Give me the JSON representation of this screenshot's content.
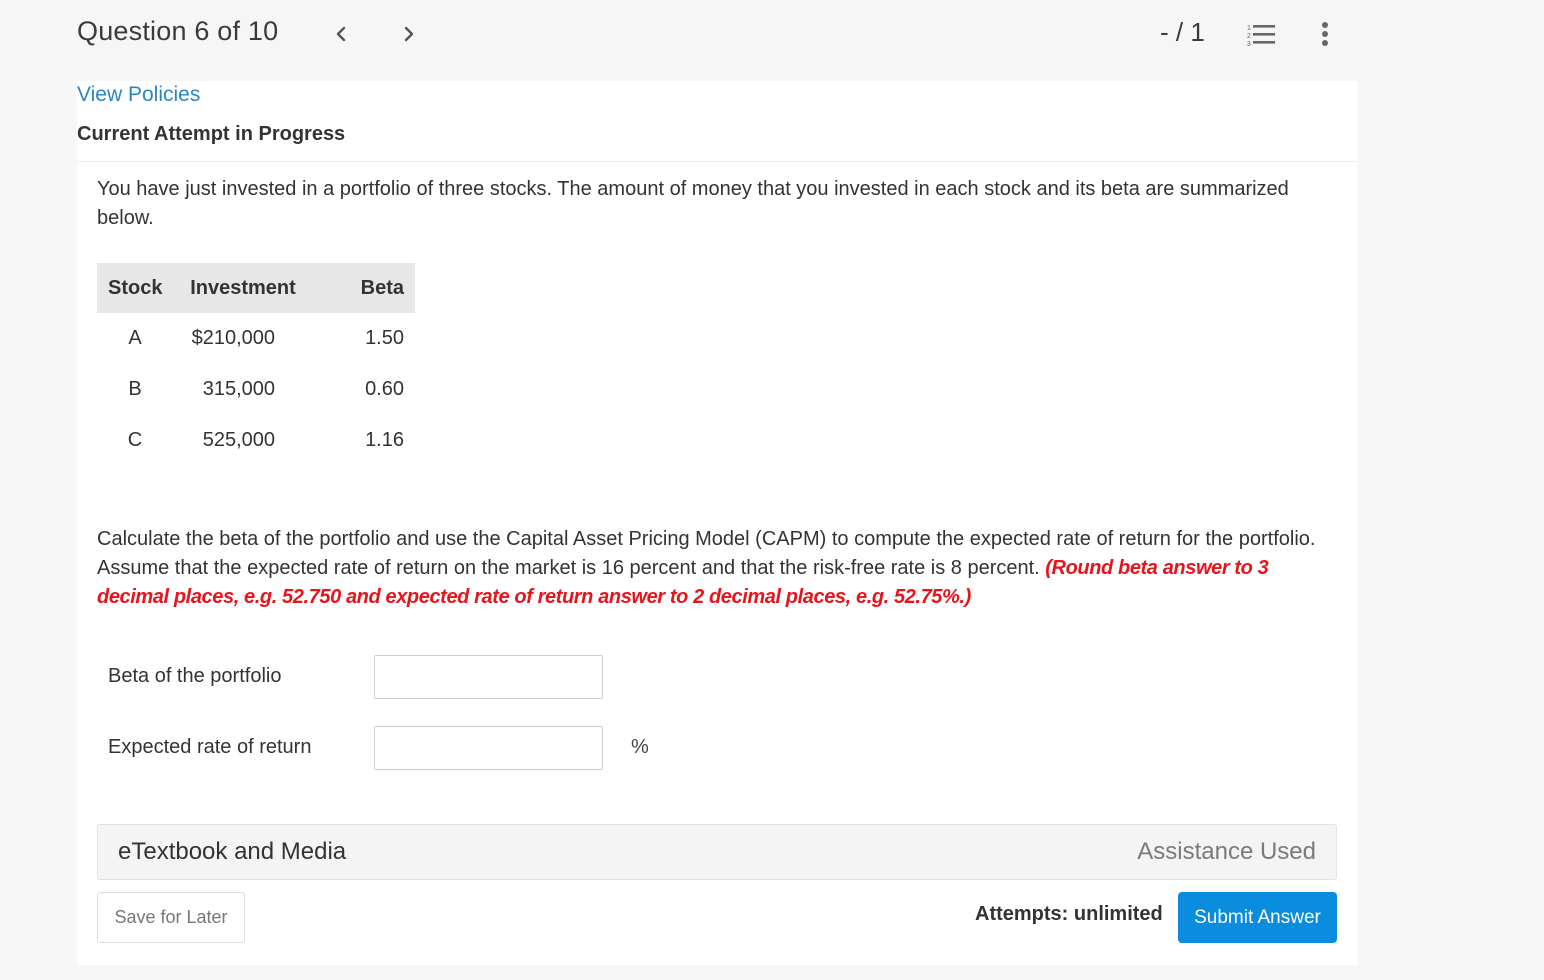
{
  "header": {
    "question_counter": "Question 6 of 10",
    "prev_icon": "chevron-left-icon",
    "next_icon": "chevron-right-icon",
    "score": "- / 1",
    "list_icon": "numbered-list-icon",
    "more_icon": "more-vertical-icon"
  },
  "links": {
    "view_policies": "View Policies"
  },
  "status": {
    "attempt_heading": "Current Attempt in Progress"
  },
  "question": {
    "intro": "You have just invested in a portfolio of three stocks. The amount of money that you invested in each stock and its beta are summarized below.",
    "table": {
      "headers": [
        "Stock",
        "Investment",
        "Beta"
      ],
      "rows": [
        [
          "A",
          "$210,000",
          "1.50"
        ],
        [
          "B",
          "315,000",
          "0.60"
        ],
        [
          "C",
          "525,000",
          "1.16"
        ]
      ]
    },
    "prompt": "Calculate the beta of the portfolio and use the Capital Asset Pricing Model (CAPM) to compute the expected rate of return for the portfolio. Assume that the expected rate of return on the market is 16 percent and that the risk-free rate is 8 percent. ",
    "instruction": "(Round beta answer to 3 decimal places, e.g. 52.750 and expected rate of return answer to 2 decimal places, e.g. 52.75%.)",
    "instruction_color": "#e8141c"
  },
  "fields": {
    "beta_label": "Beta of the portfolio",
    "beta_value": "",
    "return_label": "Expected rate of return",
    "return_value": "",
    "return_unit": "%"
  },
  "resources": {
    "etextbook_label": "eTextbook and Media",
    "assistance_label": "Assistance Used"
  },
  "footer": {
    "save_label": "Save for Later",
    "attempts_text": "Attempts: unlimited",
    "submit_label": "Submit Answer",
    "submit_color": "#0b8ddf"
  }
}
